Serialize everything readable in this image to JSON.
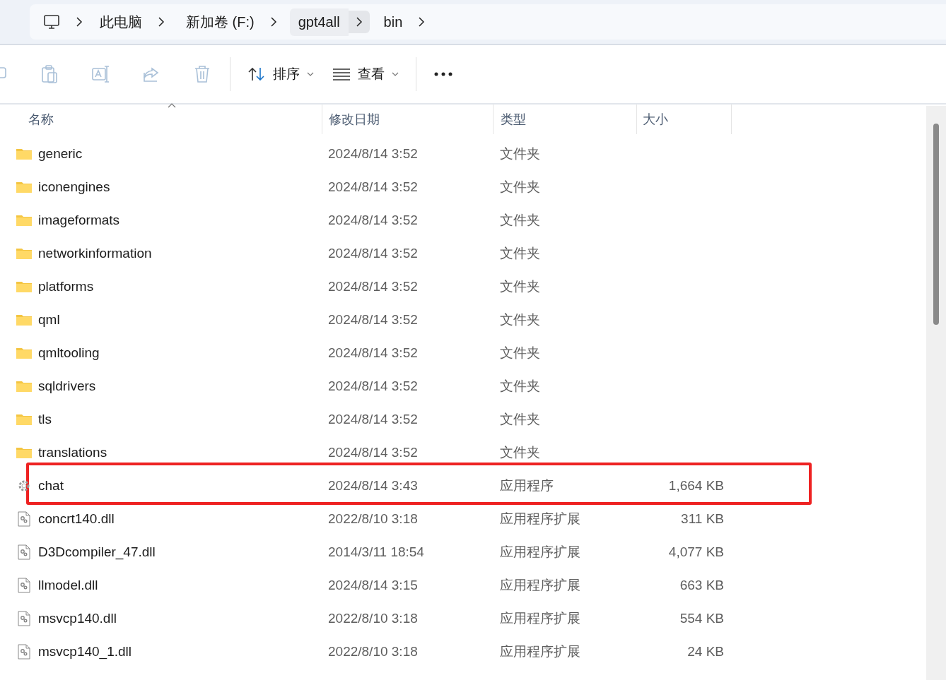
{
  "breadcrumb": [
    {
      "label": "此电脑",
      "hovered": false
    },
    {
      "label": "新加卷 (F:)",
      "hovered": false
    },
    {
      "label": "gpt4all",
      "hovered": true
    },
    {
      "label": "bin",
      "hovered": false
    }
  ],
  "toolbar": {
    "actions": [
      {
        "kind": "cut",
        "disabled": true
      },
      {
        "kind": "paste",
        "disabled": true
      },
      {
        "kind": "rename",
        "disabled": true
      },
      {
        "kind": "share",
        "disabled": true
      },
      {
        "kind": "delete",
        "disabled": true
      }
    ],
    "sort": "排序",
    "view": "查看"
  },
  "table": {
    "columns": [
      "名称",
      "修改日期",
      "类型",
      "大小"
    ],
    "rows": [
      {
        "kind": "folder",
        "name": "generic",
        "date": "2024/8/14 3:52",
        "type": "文件夹",
        "highlighted": false
      },
      {
        "kind": "folder",
        "name": "iconengines",
        "date": "2024/8/14 3:52",
        "type": "文件夹",
        "highlighted": false
      },
      {
        "kind": "folder",
        "name": "imageformats",
        "date": "2024/8/14 3:52",
        "type": "文件夹",
        "highlighted": false
      },
      {
        "kind": "folder",
        "name": "networkinformation",
        "date": "2024/8/14 3:52",
        "type": "文件夹",
        "highlighted": false
      },
      {
        "kind": "folder",
        "name": "platforms",
        "date": "2024/8/14 3:52",
        "type": "文件夹",
        "highlighted": false
      },
      {
        "kind": "folder",
        "name": "qml",
        "date": "2024/8/14 3:52",
        "type": "文件夹",
        "highlighted": false
      },
      {
        "kind": "folder",
        "name": "qmltooling",
        "date": "2024/8/14 3:52",
        "type": "文件夹",
        "highlighted": false
      },
      {
        "kind": "folder",
        "name": "sqldrivers",
        "date": "2024/8/14 3:52",
        "type": "文件夹",
        "highlighted": false
      },
      {
        "kind": "folder",
        "name": "tls",
        "date": "2024/8/14 3:52",
        "type": "文件夹",
        "highlighted": false
      },
      {
        "kind": "folder",
        "name": "translations",
        "date": "2024/8/14 3:52",
        "type": "文件夹",
        "highlighted": false
      },
      {
        "kind": "app",
        "name": "chat",
        "date": "2024/8/14 3:43",
        "type": "应用程序",
        "size": "1,664 KB",
        "highlighted": true
      },
      {
        "kind": "dll",
        "name": "concrt140.dll",
        "date": "2022/8/10 3:18",
        "type": "应用程序扩展",
        "size": "311 KB",
        "highlighted": false
      },
      {
        "kind": "dll",
        "name": "D3Dcompiler_47.dll",
        "date": "2014/3/11 18:54",
        "type": "应用程序扩展",
        "size": "4,077 KB",
        "highlighted": false
      },
      {
        "kind": "dll",
        "name": "llmodel.dll",
        "date": "2024/8/14 3:15",
        "type": "应用程序扩展",
        "size": "663 KB",
        "highlighted": false
      },
      {
        "kind": "dll",
        "name": "msvcp140.dll",
        "date": "2022/8/10 3:18",
        "type": "应用程序扩展",
        "size": "554 KB",
        "highlighted": false
      },
      {
        "kind": "dll",
        "name": "msvcp140_1.dll",
        "date": "2022/8/10 3:18",
        "type": "应用程序扩展",
        "size": "24 KB",
        "highlighted": false
      }
    ]
  }
}
